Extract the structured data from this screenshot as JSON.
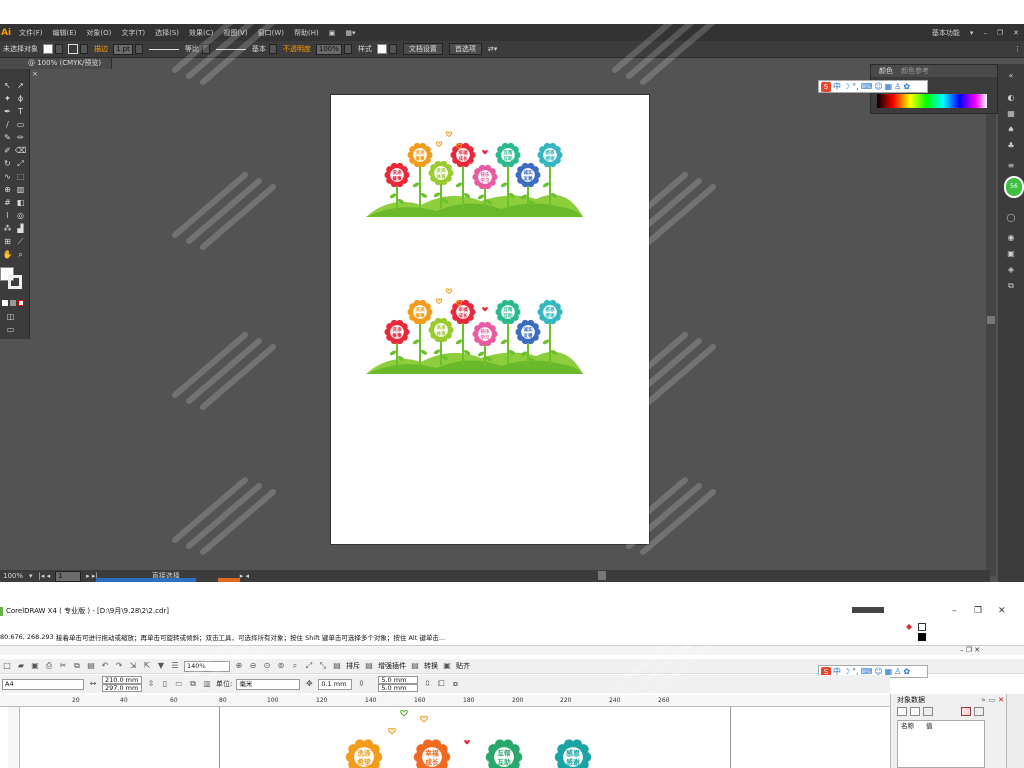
{
  "illustrator": {
    "logo": "Ai",
    "menu": [
      "文件(F)",
      "编辑(E)",
      "对象(O)",
      "文字(T)",
      "选择(S)",
      "效果(C)",
      "视图(V)",
      "窗口(W)",
      "帮助(H)"
    ],
    "workspace": "基本功能",
    "control": {
      "selection": "未选择对象",
      "stroke_label": "描边",
      "stroke_weight": "1 pt",
      "profile": "等比",
      "brush": "基本",
      "opacity_label": "不透明度",
      "opacity_value": "100%",
      "style_label": "样式",
      "doc_setup": "文档设置",
      "preferences": "首选项"
    },
    "doc_tab": "@ 100% (CMYK/预览)",
    "color_panel": {
      "tab_active": "颜色",
      "tab_other": "颜色参考"
    },
    "ime": {
      "chinese": "中"
    },
    "status": {
      "zoom": "100%",
      "page": "1",
      "tool": "直接选择"
    },
    "dock_badge": "56"
  },
  "coreldraw": {
    "title": "CorelDRAW X4 ( 专业版 ) - [D:\\9月\\9.28\\2\\2.cdr]",
    "coords": "80.676, 268.293 )",
    "hint": "接着单击可进行拖动或缩放；再单击可旋转或倾斜；双击工具，可选择所有对象；按住 Shift 键单击可选择多个对象；按住 Alt 键单击...",
    "toolbar": {
      "zoom": "140%",
      "snap_label": "排斥",
      "plugin_label": "增强插件",
      "convert_label": "转换",
      "paste_label": "贴齐"
    },
    "props": {
      "paper": "A4",
      "width": "210.0 mm",
      "height": "297.0 mm",
      "unit_label": "单位:",
      "unit": "毫米",
      "nudge": "0.1 mm",
      "dup_x": "5.0 mm",
      "dup_y": "5.0 mm"
    },
    "ruler_ticks": [
      "20",
      "40",
      "60",
      "80",
      "100",
      "120",
      "140",
      "160",
      "180",
      "200",
      "220",
      "240",
      "260"
    ],
    "obj_panel": {
      "title": "对象数据",
      "col_name": "名称",
      "col_value": "值"
    }
  },
  "artwork": {
    "flowers_top": [
      {
        "text": "洗涤\n餐事",
        "color": "#e9283a"
      },
      {
        "text": "洗涤\n餐事",
        "color": "#f39c1b"
      },
      {
        "text": "洗涤\n体育",
        "color": "#9acb2d"
      },
      {
        "text": "幸福\n成长",
        "color": "#e9283a"
      },
      {
        "text": "快乐\n学习",
        "color": "#e85aa1"
      },
      {
        "text": "互帮\n互助",
        "color": "#29b98f"
      },
      {
        "text": "诚实\n友善",
        "color": "#3c6cc2"
      },
      {
        "text": "感恩\n感谢",
        "color": "#35b7c3"
      }
    ],
    "partial_flowers": [
      {
        "text": "洗涤\n希望",
        "color": "#f39c1b"
      },
      {
        "text": "幸福\n成长",
        "color": "#ef6a1f"
      },
      {
        "text": "互帮\n互助",
        "color": "#29a86b"
      },
      {
        "text": "感恩\n感谢",
        "color": "#1aa4a4"
      }
    ]
  },
  "colors": {
    "ai_bg": "#535353",
    "ai_panel": "#3c3c3c",
    "ai_accent": "#ff9a00",
    "cd_bg": "#ffffff"
  }
}
